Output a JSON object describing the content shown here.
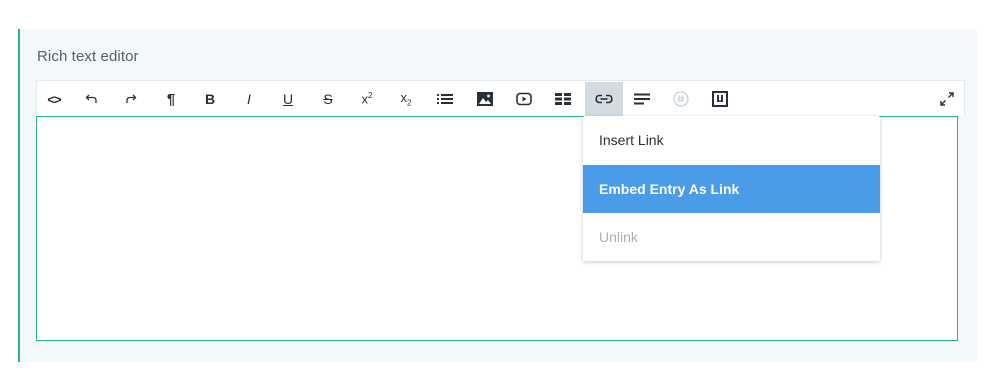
{
  "field": {
    "label": "Rich text editor"
  },
  "toolbar": {
    "buttons": [
      {
        "name": "code-view-icon",
        "glyph": "<>"
      },
      {
        "name": "undo-icon"
      },
      {
        "name": "redo-icon"
      },
      {
        "name": "paragraph-icon",
        "glyph": "¶"
      },
      {
        "name": "bold-icon",
        "glyph": "B"
      },
      {
        "name": "italic-icon",
        "glyph": "I"
      },
      {
        "name": "underline-icon",
        "glyph": "U"
      },
      {
        "name": "strikethrough-icon",
        "glyph": "S"
      },
      {
        "name": "superscript-icon",
        "glyph": "x"
      },
      {
        "name": "subscript-icon",
        "glyph": "x"
      },
      {
        "name": "bulleted-list-icon"
      },
      {
        "name": "image-icon"
      },
      {
        "name": "video-icon"
      },
      {
        "name": "table-icon"
      },
      {
        "name": "link-icon",
        "active": true
      },
      {
        "name": "align-icon"
      },
      {
        "name": "special-char-icon",
        "disabled": true
      },
      {
        "name": "embed-entry-icon"
      },
      {
        "name": "fullscreen-icon"
      }
    ]
  },
  "link_menu": {
    "items": [
      {
        "label": "Insert Link",
        "state": "normal"
      },
      {
        "label": "Embed Entry As Link",
        "state": "highlighted"
      },
      {
        "label": "Unlink",
        "state": "disabled"
      }
    ]
  },
  "colors": {
    "accent": "#2bb38f",
    "highlight": "#4a9be8",
    "label": "#536171",
    "field_bg": "#f3f8fb"
  }
}
